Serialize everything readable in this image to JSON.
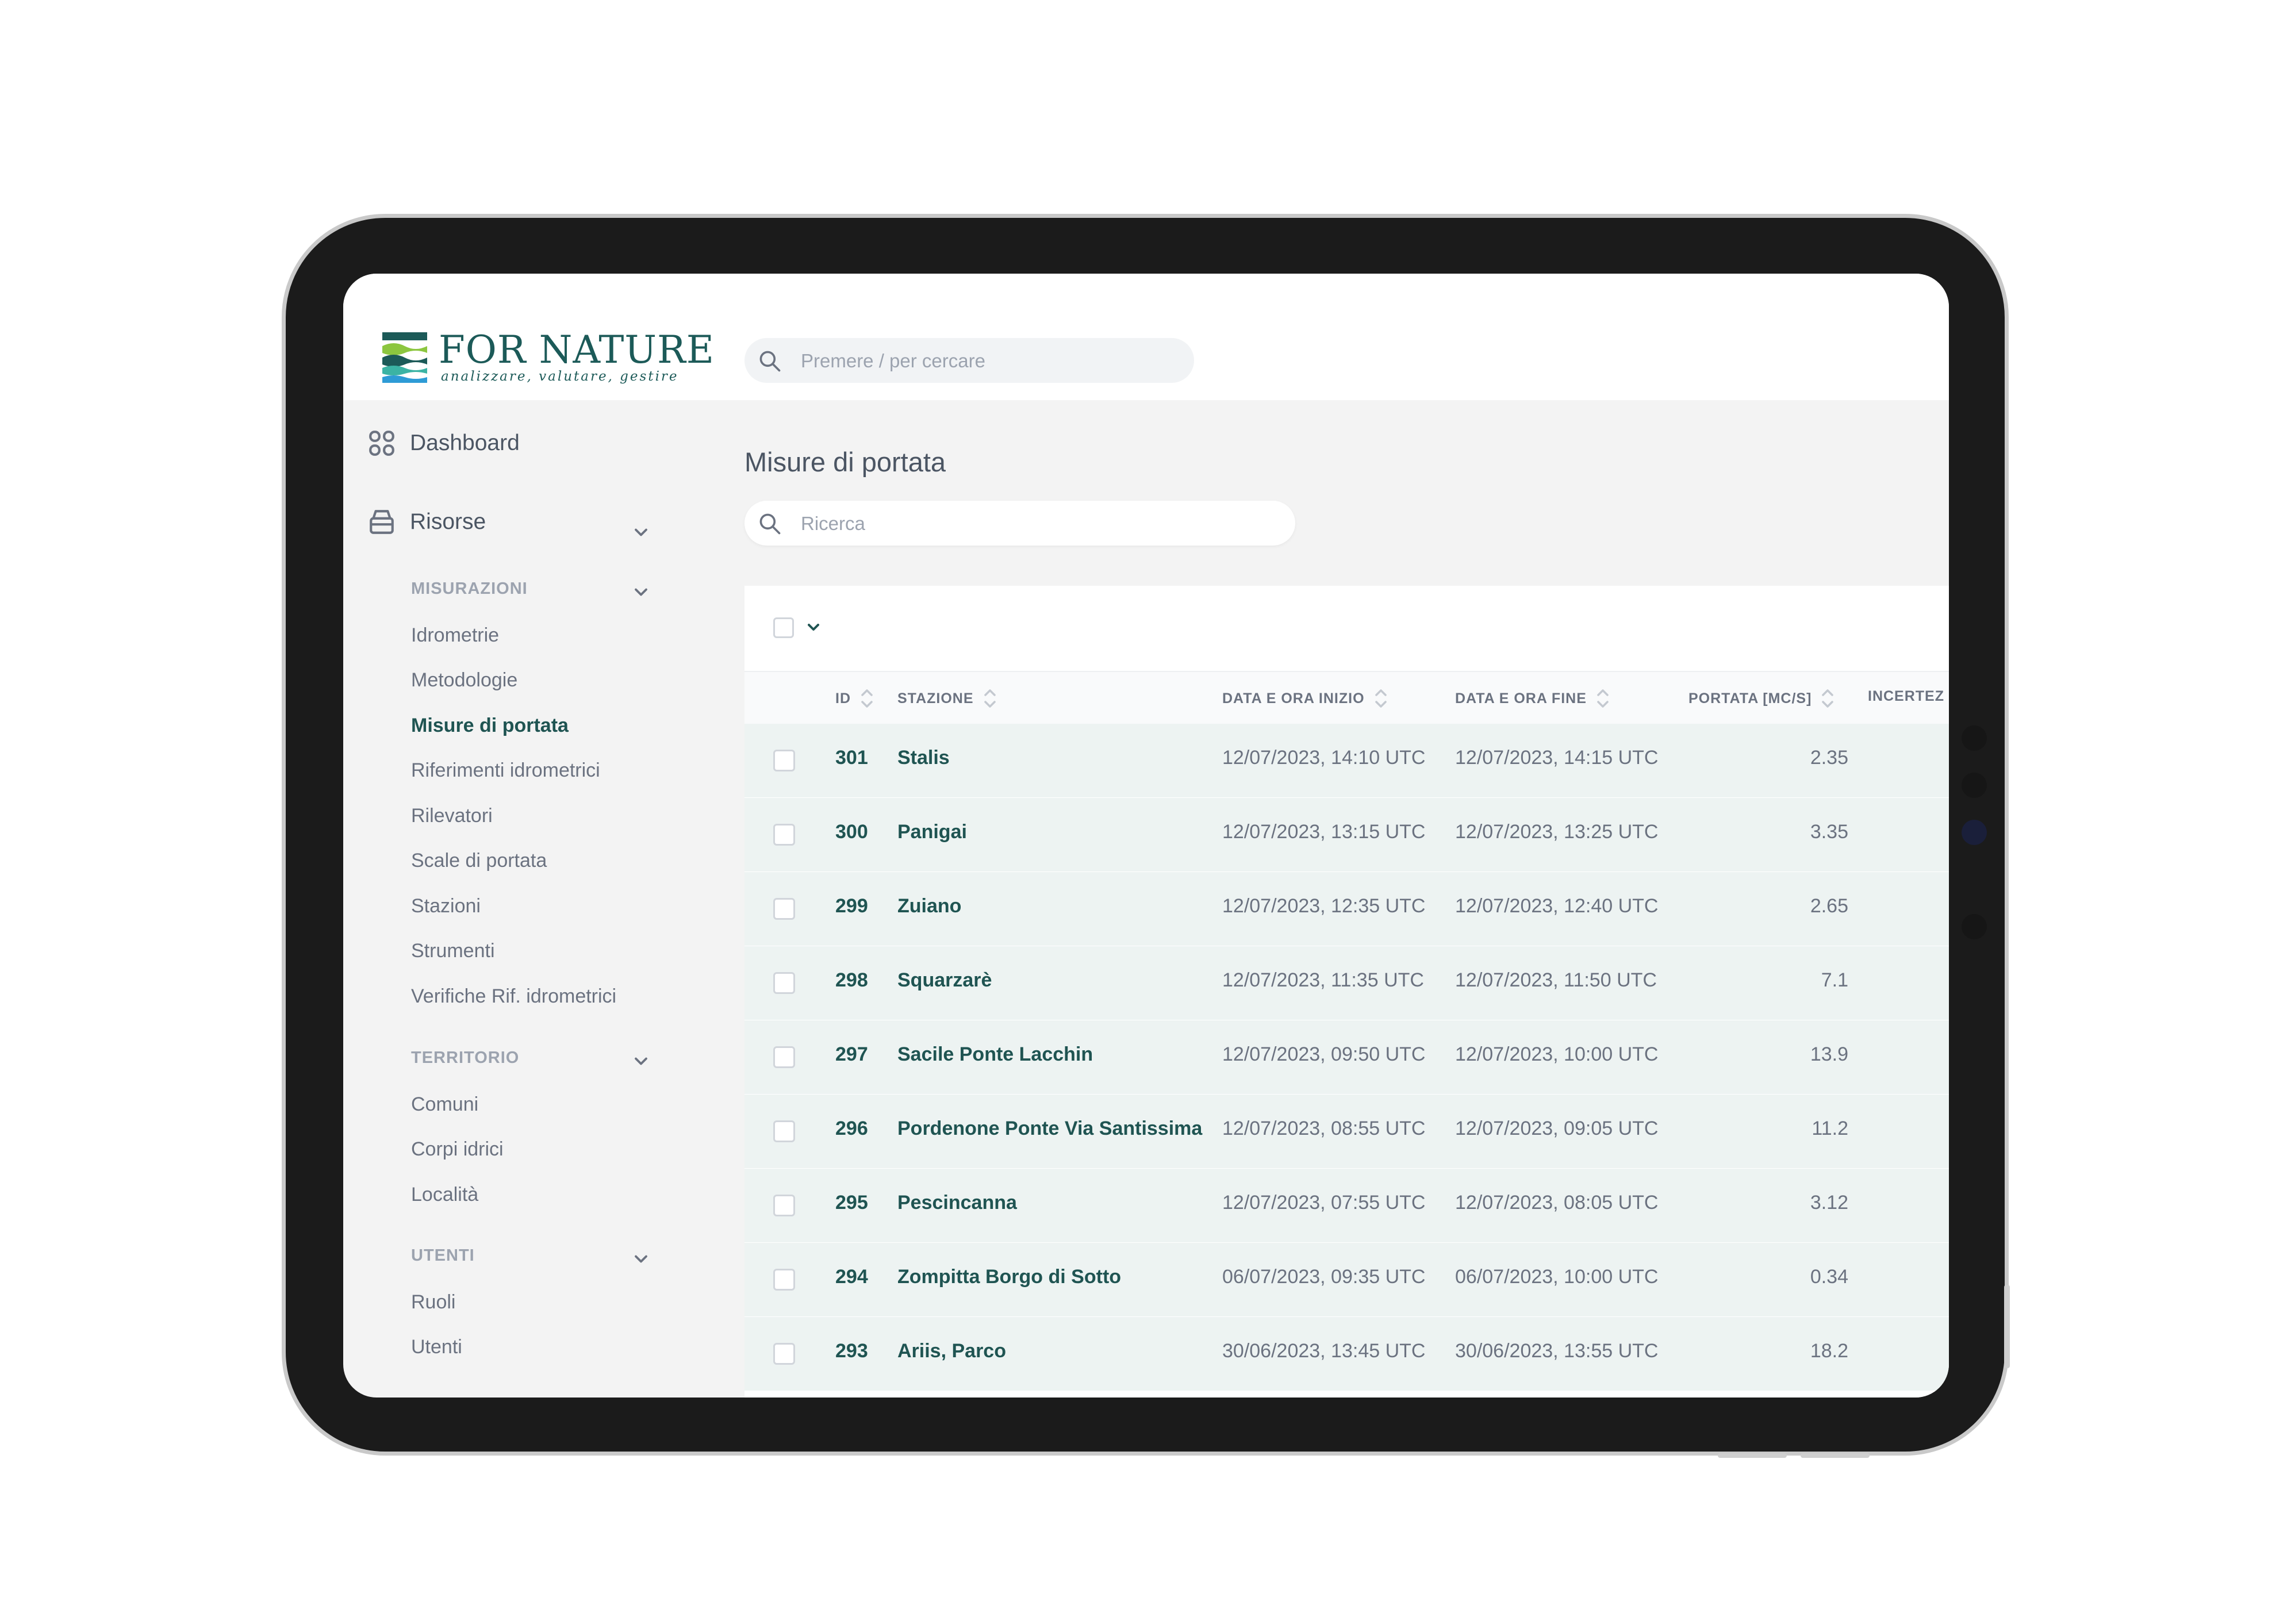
{
  "brand": {
    "name": "FOR NATURE",
    "tagline": "analizzare, valutare, gestire",
    "colors": {
      "primary": "#1c5a58",
      "green": "#8cc63f",
      "blue": "#2e9bd6",
      "teal": "#3bb3a4"
    }
  },
  "header": {
    "search_placeholder": "Premere / per cercare"
  },
  "sidebar": {
    "dashboard": "Dashboard",
    "resources": "Risorse",
    "sections": [
      {
        "title": "MISURAZIONI",
        "items": [
          "Idrometrie",
          "Metodologie",
          "Misure di portata",
          "Riferimenti idrometrici",
          "Rilevatori",
          "Scale di portata",
          "Stazioni",
          "Strumenti",
          "Verifiche Rif. idrometrici"
        ]
      },
      {
        "title": "TERRITORIO",
        "items": [
          "Comuni",
          "Corpi idrici",
          "Località"
        ]
      },
      {
        "title": "UTENTI",
        "items": [
          "Ruoli",
          "Utenti"
        ]
      }
    ],
    "active_item": "Misure di portata"
  },
  "main": {
    "title": "Misure di portata",
    "search_placeholder": "Ricerca"
  },
  "table": {
    "columns": [
      "ID",
      "STAZIONE",
      "DATA E ORA INIZIO",
      "DATA E ORA FINE",
      "PORTATA [MC/S]",
      "INCERTEZ"
    ],
    "rows": [
      {
        "id": "301",
        "station": "Stalis",
        "start": "12/07/2023, 14:10 UTC",
        "end": "12/07/2023, 14:15 UTC",
        "flow": "2.35"
      },
      {
        "id": "300",
        "station": "Panigai",
        "start": "12/07/2023, 13:15 UTC",
        "end": "12/07/2023, 13:25 UTC",
        "flow": "3.35"
      },
      {
        "id": "299",
        "station": "Zuiano",
        "start": "12/07/2023, 12:35 UTC",
        "end": "12/07/2023, 12:40 UTC",
        "flow": "2.65"
      },
      {
        "id": "298",
        "station": "Squarzarè",
        "start": "12/07/2023, 11:35 UTC",
        "end": "12/07/2023, 11:50 UTC",
        "flow": "7.1"
      },
      {
        "id": "297",
        "station": "Sacile Ponte Lacchin",
        "start": "12/07/2023, 09:50 UTC",
        "end": "12/07/2023, 10:00 UTC",
        "flow": "13.9"
      },
      {
        "id": "296",
        "station": "Pordenone Ponte Via Santissima",
        "start": "12/07/2023, 08:55 UTC",
        "end": "12/07/2023, 09:05 UTC",
        "flow": "11.2"
      },
      {
        "id": "295",
        "station": "Pescincanna",
        "start": "12/07/2023, 07:55 UTC",
        "end": "12/07/2023, 08:05 UTC",
        "flow": "3.12"
      },
      {
        "id": "294",
        "station": "Zompitta Borgo di Sotto",
        "start": "06/07/2023, 09:35 UTC",
        "end": "06/07/2023, 10:00 UTC",
        "flow": "0.34"
      },
      {
        "id": "293",
        "station": "Ariis, Parco",
        "start": "30/06/2023, 13:45 UTC",
        "end": "30/06/2023, 13:55 UTC",
        "flow": "18.2"
      }
    ]
  }
}
